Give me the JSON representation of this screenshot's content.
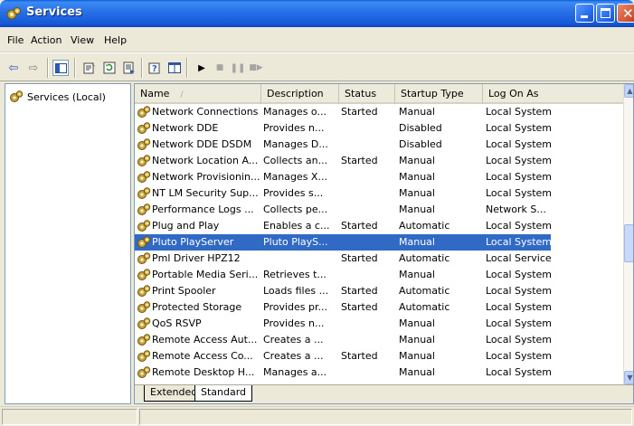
{
  "window": {
    "title": "Services",
    "icon": "services-gear-icon"
  },
  "menu": [
    "File",
    "Action",
    "View",
    "Help"
  ],
  "toolbar": {
    "icons": [
      "back-arrow-icon",
      "forward-arrow-icon",
      "show-hide-console-tree-icon",
      "properties-icon",
      "refresh-icon",
      "export-list-icon",
      "help-icon",
      "extended-view-icon",
      "start-service-icon",
      "stop-service-icon",
      "pause-service-icon",
      "restart-service-icon"
    ]
  },
  "tree": {
    "root_label": "Services (Local)"
  },
  "columns": [
    "Name",
    "Description",
    "Status",
    "Startup Type",
    "Log On As"
  ],
  "rows": [
    {
      "name": "Network Connections",
      "description": "Manages o...",
      "status": "Started",
      "startup": "Manual",
      "logon": "Local System"
    },
    {
      "name": "Network DDE",
      "description": "Provides n...",
      "status": "",
      "startup": "Disabled",
      "logon": "Local System"
    },
    {
      "name": "Network DDE DSDM",
      "description": "Manages D...",
      "status": "",
      "startup": "Disabled",
      "logon": "Local System"
    },
    {
      "name": "Network Location A...",
      "description": "Collects an...",
      "status": "Started",
      "startup": "Manual",
      "logon": "Local System"
    },
    {
      "name": "Network Provisionin...",
      "description": "Manages X...",
      "status": "",
      "startup": "Manual",
      "logon": "Local System"
    },
    {
      "name": "NT LM Security Sup...",
      "description": "Provides s...",
      "status": "",
      "startup": "Manual",
      "logon": "Local System"
    },
    {
      "name": "Performance Logs ...",
      "description": "Collects pe...",
      "status": "",
      "startup": "Manual",
      "logon": "Network S..."
    },
    {
      "name": "Plug and Play",
      "description": "Enables a c...",
      "status": "Started",
      "startup": "Automatic",
      "logon": "Local System"
    },
    {
      "name": "Pluto PlayServer",
      "description": "Pluto PlayS...",
      "status": "",
      "startup": "Manual",
      "logon": "Local System",
      "selected": true
    },
    {
      "name": "Pml Driver HPZ12",
      "description": "",
      "status": "Started",
      "startup": "Automatic",
      "logon": "Local Service"
    },
    {
      "name": "Portable Media Seri...",
      "description": "Retrieves t...",
      "status": "",
      "startup": "Manual",
      "logon": "Local System"
    },
    {
      "name": "Print Spooler",
      "description": "Loads files ...",
      "status": "Started",
      "startup": "Automatic",
      "logon": "Local System"
    },
    {
      "name": "Protected Storage",
      "description": "Provides pr...",
      "status": "Started",
      "startup": "Automatic",
      "logon": "Local System"
    },
    {
      "name": "QoS RSVP",
      "description": "Provides n...",
      "status": "",
      "startup": "Manual",
      "logon": "Local System"
    },
    {
      "name": "Remote Access Aut...",
      "description": "Creates a ...",
      "status": "",
      "startup": "Manual",
      "logon": "Local System"
    },
    {
      "name": "Remote Access Co...",
      "description": "Creates a ...",
      "status": "Started",
      "startup": "Manual",
      "logon": "Local System"
    },
    {
      "name": "Remote Desktop H...",
      "description": "Manages a...",
      "status": "",
      "startup": "Manual",
      "logon": "Local System"
    }
  ],
  "tabs": [
    "Extended",
    "Standard"
  ],
  "colors": {
    "selection": "#316ac5",
    "titlebar": "#2a72e8"
  }
}
